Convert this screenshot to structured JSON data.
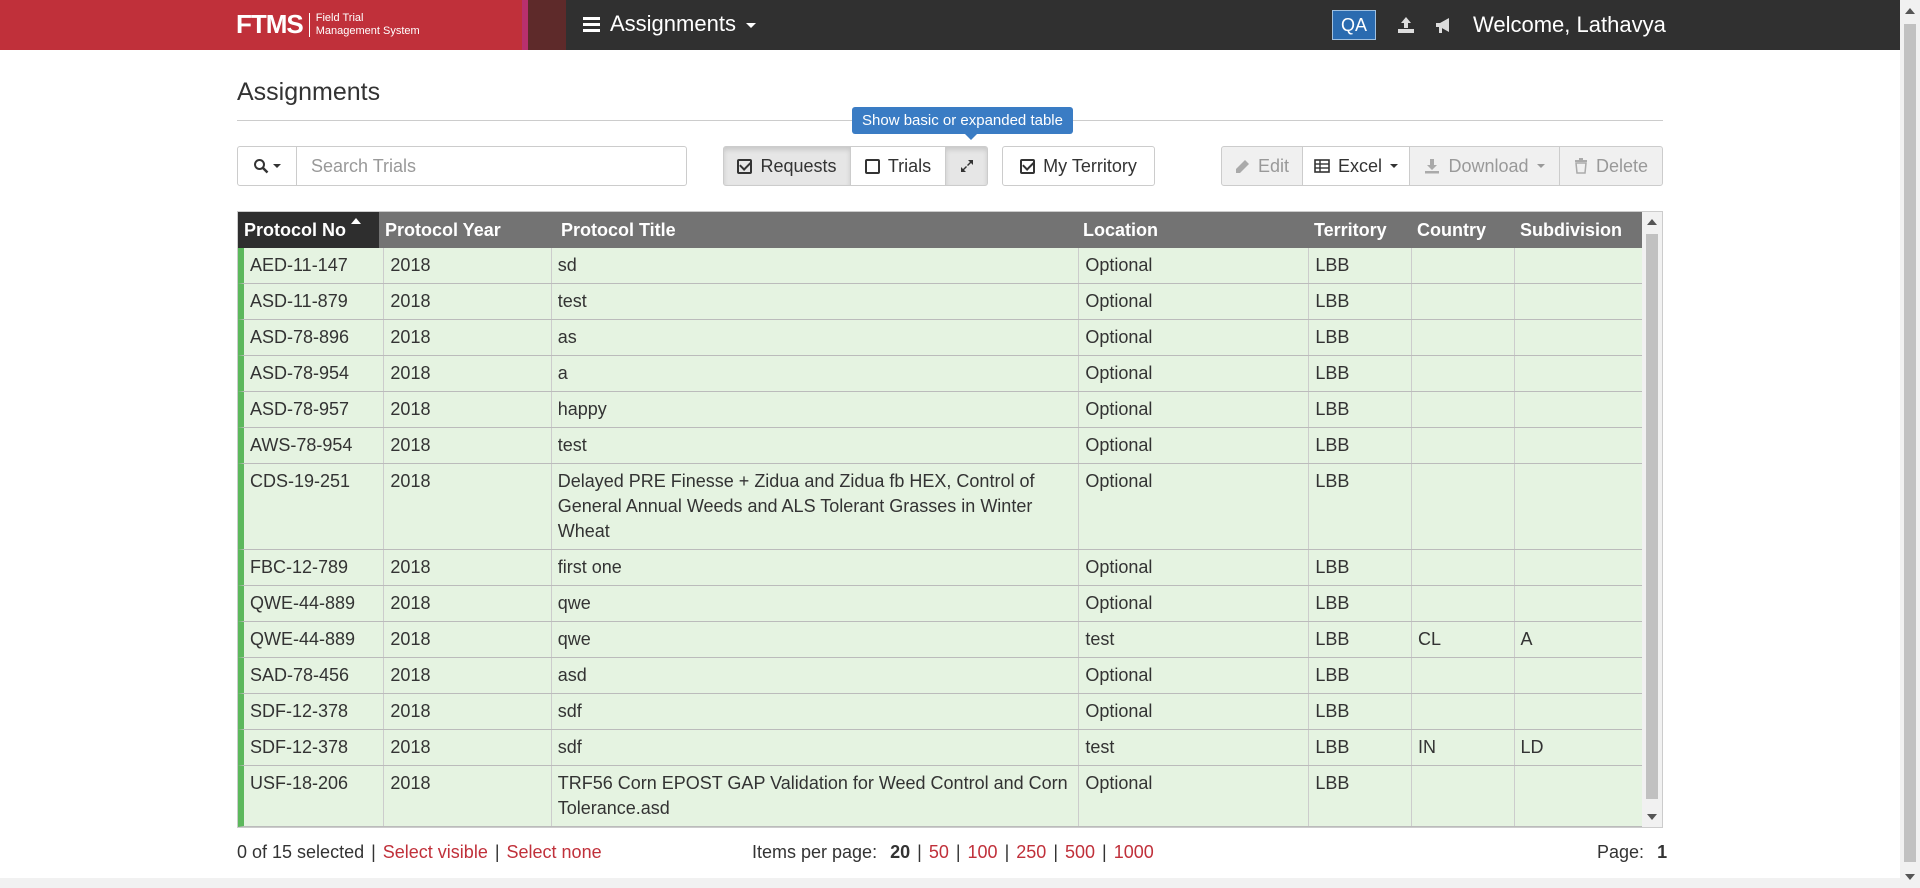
{
  "brand": {
    "logo": "FTMS",
    "sub_line1": "Field Trial",
    "sub_line2": "Management System"
  },
  "nav": {
    "title": "Assignments",
    "env_badge": "QA",
    "welcome": "Welcome, Lathavya"
  },
  "page": {
    "title": "Assignments"
  },
  "tooltip": "Show basic or expanded table",
  "toolbar": {
    "search_placeholder": "Search Trials",
    "requests_label": "Requests",
    "requests_checked": true,
    "trials_label": "Trials",
    "trials_checked": false,
    "my_territory_label": "My Territory",
    "my_territory_checked": true,
    "edit_label": "Edit",
    "excel_label": "Excel",
    "download_label": "Download",
    "delete_label": "Delete"
  },
  "table": {
    "columns": [
      "Protocol No",
      "Protocol Year",
      "Protocol Title",
      "Location",
      "Territory",
      "Country",
      "Subdivision"
    ],
    "rows": [
      [
        "AED-11-147",
        "2018",
        "sd",
        "Optional",
        "LBB",
        "",
        ""
      ],
      [
        "ASD-11-879",
        "2018",
        "test",
        "Optional",
        "LBB",
        "",
        ""
      ],
      [
        "ASD-78-896",
        "2018",
        "as",
        "Optional",
        "LBB",
        "",
        ""
      ],
      [
        "ASD-78-954",
        "2018",
        "a",
        "Optional",
        "LBB",
        "",
        ""
      ],
      [
        "ASD-78-957",
        "2018",
        "happy",
        "Optional",
        "LBB",
        "",
        ""
      ],
      [
        "AWS-78-954",
        "2018",
        "test",
        "Optional",
        "LBB",
        "",
        ""
      ],
      [
        "CDS-19-251",
        "2018",
        "Delayed PRE Finesse + Zidua and Zidua fb HEX, Control of General Annual Weeds and ALS Tolerant Grasses in Winter Wheat",
        "Optional",
        "LBB",
        "",
        ""
      ],
      [
        "FBC-12-789",
        "2018",
        "first one",
        "Optional",
        "LBB",
        "",
        ""
      ],
      [
        "QWE-44-889",
        "2018",
        "qwe",
        "Optional",
        "LBB",
        "",
        ""
      ],
      [
        "QWE-44-889",
        "2018",
        "qwe",
        "test",
        "LBB",
        "CL",
        "A"
      ],
      [
        "SAD-78-456",
        "2018",
        "asd",
        "Optional",
        "LBB",
        "",
        ""
      ],
      [
        "SDF-12-378",
        "2018",
        "sdf",
        "Optional",
        "LBB",
        "",
        ""
      ],
      [
        "SDF-12-378",
        "2018",
        "sdf",
        "test",
        "LBB",
        "IN",
        "LD"
      ],
      [
        "USF-18-206",
        "2018",
        "TRF56 Corn EPOST GAP Validation for Weed Control and Corn Tolerance.asd",
        "Optional",
        "LBB",
        "",
        ""
      ]
    ]
  },
  "footer": {
    "selection_text": "0 of 15 selected",
    "select_visible": "Select visible",
    "select_none": "Select none",
    "items_per_page_label": "Items per page:",
    "page_sizes": [
      "20",
      "50",
      "100",
      "250",
      "500",
      "1000"
    ],
    "page_label": "Page:",
    "page_number": "1"
  },
  "colors": {
    "brand_red": "#c0303a",
    "row_green": "#e5f3e1",
    "row_marker": "#5cb85c",
    "header_gray": "#737373",
    "tooltip_blue": "#3a7cc4"
  },
  "icons": [
    "menu-icon",
    "upload-icon",
    "bullhorn-icon",
    "search-icon",
    "checkbox-icon",
    "expand-icon",
    "pencil-icon",
    "table-icon",
    "download-icon",
    "trash-icon"
  ]
}
